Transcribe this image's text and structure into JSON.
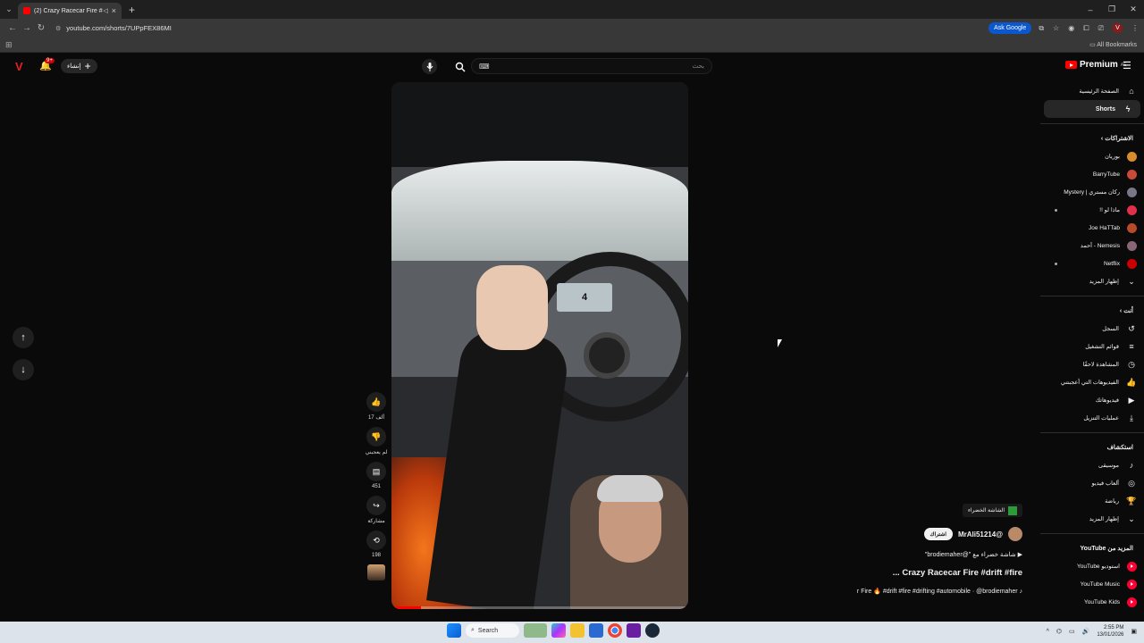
{
  "browser": {
    "tab_title": "(2) Crazy Racecar Fire #drif",
    "url": "youtube.com/shorts/7UPpFEX86MI",
    "ask_google": "Ask Google",
    "all_bookmarks": "All Bookmarks"
  },
  "header": {
    "create_label": "إنشاء",
    "search_placeholder": "بحث",
    "premium_label": "Premium",
    "premium_region": "AE"
  },
  "video": {
    "gear": "4",
    "progress": 0.1
  },
  "actions": {
    "likes": "17 ألف",
    "dislike": "لم يعجبني",
    "comments": "451",
    "share": "مشاركة",
    "remix": "198"
  },
  "meta": {
    "chip": "الشاشة الخضراء",
    "channel": "@MrAli51214",
    "subscribe": "اشتراك",
    "sound": "شاشة خضراء مع \"@brodiemaher\"",
    "title": "Crazy Racecar Fire #drift #fire ...",
    "tags": "r Fire 🔥 #drift #fire #drifting #automobile · @brodiemaher"
  },
  "sidebar": {
    "home": "الصفحة الرئيسية",
    "shorts": "Shorts",
    "subscriptions_head": "الاشتراكات",
    "subscriptions": [
      {
        "name": "بوريان",
        "color": "#d98c2b"
      },
      {
        "name": "BarryTube",
        "color": "#c84a3a"
      },
      {
        "name": "ركان مستري | Mystery",
        "color": "#777788"
      },
      {
        "name": "ماذا لو !!",
        "color": "#e0304a"
      },
      {
        "name": "Joe HaTTab",
        "color": "#b84a2a"
      },
      {
        "name": "Nemesis - أحمد",
        "color": "#886677"
      },
      {
        "name": "Netflix",
        "color": "#cc0000"
      }
    ],
    "show_more_1": "إظهار المزيد",
    "you_head": "أنت",
    "you_items": [
      {
        "label": "السجل",
        "icon": "↺"
      },
      {
        "label": "قوائم التشغيل",
        "icon": "≡"
      },
      {
        "label": "المشاهدة لاحقًا",
        "icon": "◷"
      },
      {
        "label": "الفيديوهات التي أعجبتني",
        "icon": "👍"
      },
      {
        "label": "فيديوهاتك",
        "icon": "▶"
      },
      {
        "label": "عمليات التنزيل",
        "icon": "⤓"
      }
    ],
    "explore_head": "استكشاف",
    "explore_items": [
      {
        "label": "موسيقى",
        "icon": "♪"
      },
      {
        "label": "ألعاب فيديو",
        "icon": "◎"
      },
      {
        "label": "رياضة",
        "icon": "🏆"
      }
    ],
    "show_more_2": "إظهار المزيد",
    "more_head": "المزيد من YouTube",
    "more_items": [
      "استوديو YouTube",
      "YouTube Music",
      "YouTube Kids"
    ]
  },
  "taskbar": {
    "search": "Search",
    "time": "2:55 PM",
    "date": "13/01/2026"
  }
}
